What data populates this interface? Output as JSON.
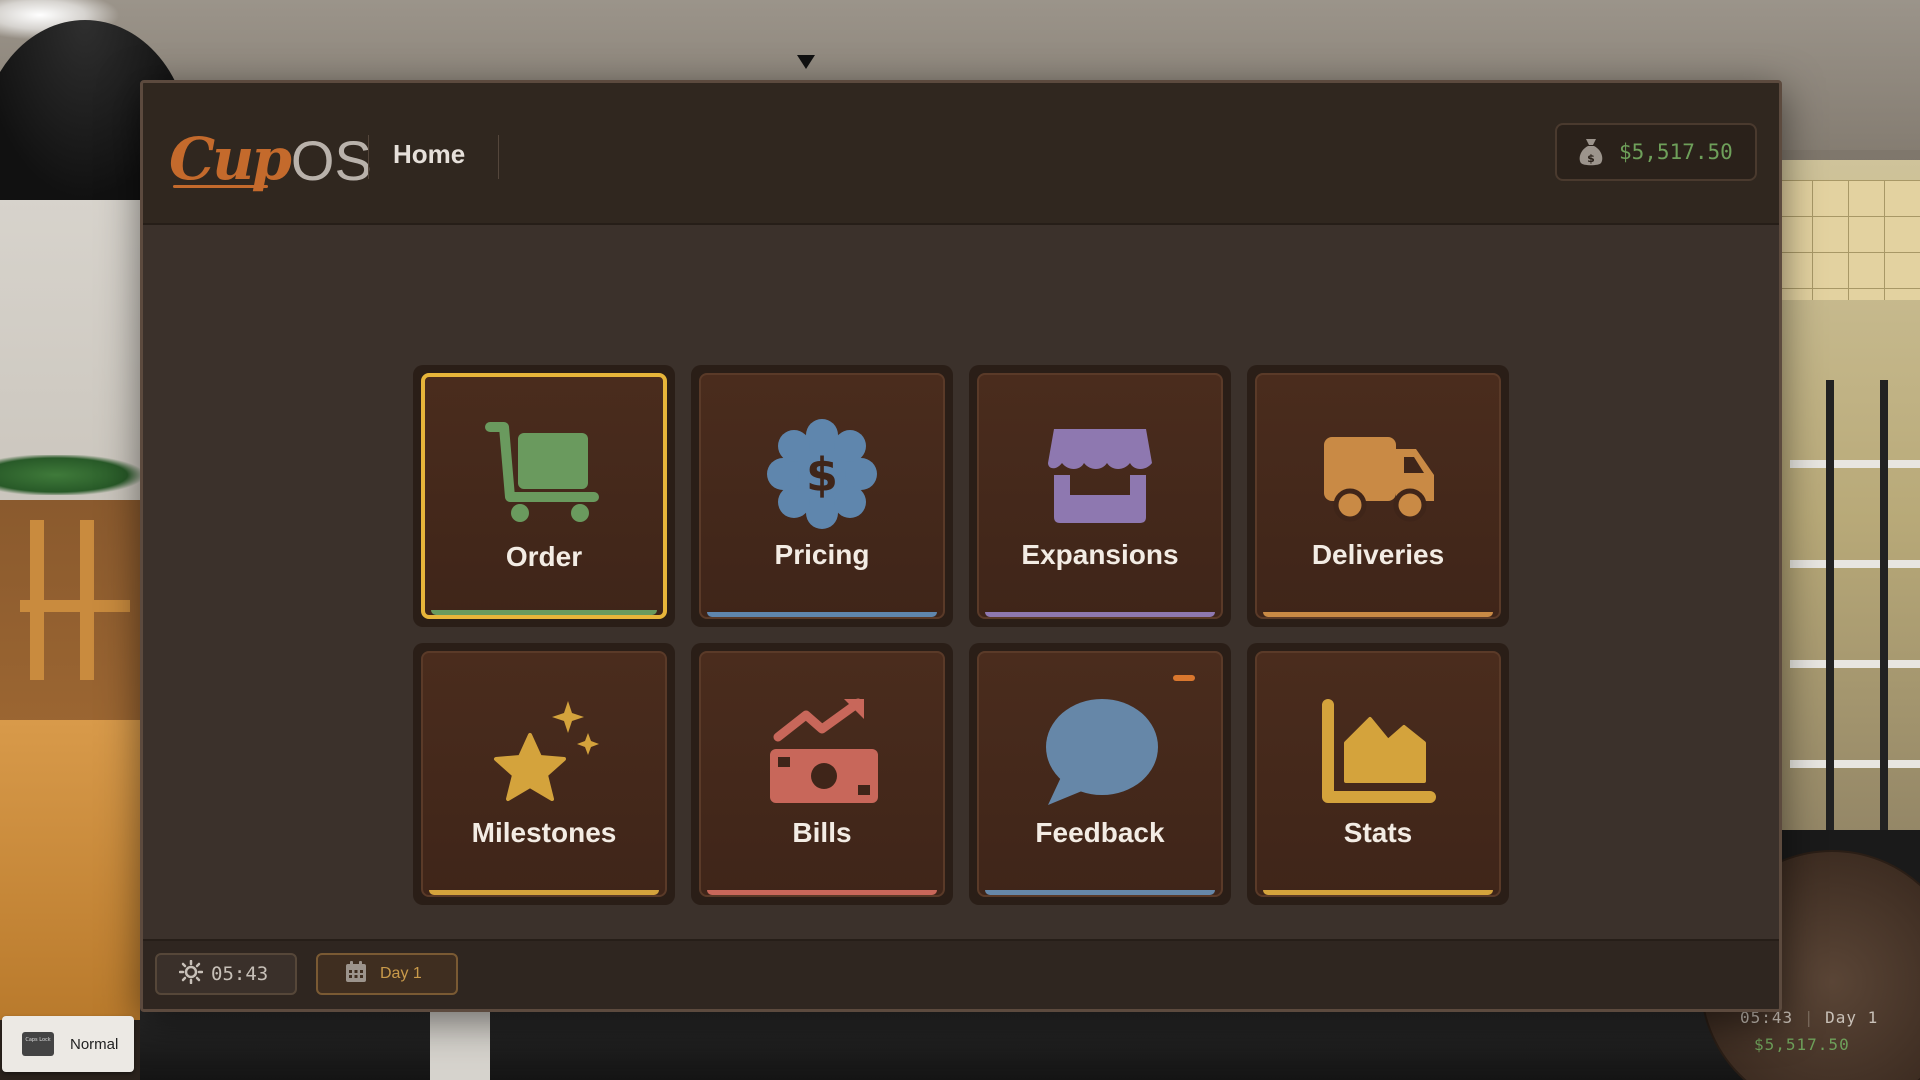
{
  "app": {
    "logo_cup": "Cup",
    "logo_os": "OS",
    "page_title": "Home",
    "balance": "$5,517.50",
    "balance_icon": "money-bag-icon"
  },
  "tiles": [
    {
      "label": "Order",
      "icon": "cart-icon",
      "color": "#6a9a5e",
      "selected": true
    },
    {
      "label": "Pricing",
      "icon": "price-badge-icon",
      "color": "#5f86ad",
      "selected": false
    },
    {
      "label": "Expansions",
      "icon": "storefront-icon",
      "color": "#8e78b0",
      "selected": false
    },
    {
      "label": "Deliveries",
      "icon": "truck-icon",
      "color": "#c98a45",
      "selected": false
    },
    {
      "label": "Milestones",
      "icon": "star-sparkle-icon",
      "color": "#d4a33c",
      "selected": false
    },
    {
      "label": "Bills",
      "icon": "cash-trend-icon",
      "color": "#c8675a",
      "selected": false
    },
    {
      "label": "Feedback",
      "icon": "speech-bubble-icon",
      "color": "#6687a8",
      "selected": false,
      "notification": true
    },
    {
      "label": "Stats",
      "icon": "area-chart-icon",
      "color": "#d4a33c",
      "selected": false
    }
  ],
  "bottombar": {
    "time": "05:43",
    "day": "Day 1"
  },
  "hud": {
    "time": "05:43",
    "day": "Day 1",
    "balance": "$5,517.50"
  },
  "capslock": {
    "key_text": "Caps Lock",
    "mode": "Normal"
  }
}
